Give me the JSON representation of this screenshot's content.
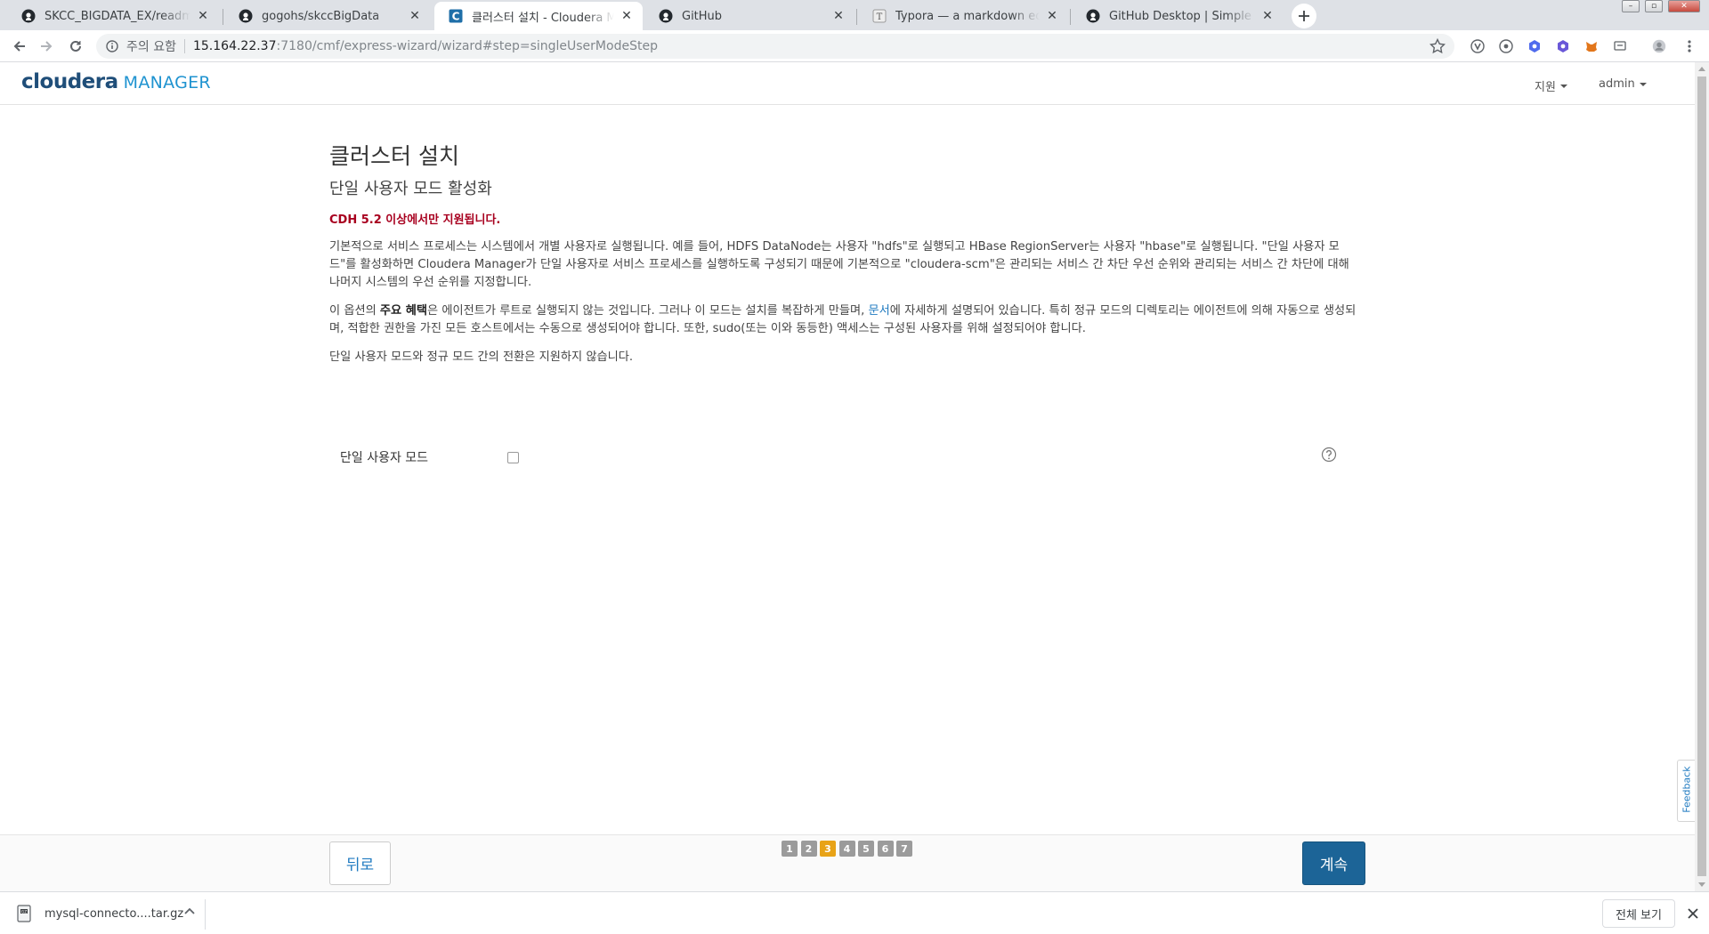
{
  "browser": {
    "tabs": [
      {
        "title": "SKCC_BIGDATA_EX/readme.md at master",
        "icon": "github-icon"
      },
      {
        "title": "gogohs/skccBigData",
        "icon": "github-icon"
      },
      {
        "title": "클러스터 설치 - Cloudera Manager",
        "icon": "cloudera-icon"
      },
      {
        "title": "GitHub",
        "icon": "github-icon"
      },
      {
        "title": "Typora — a markdown editor, markdown reader",
        "icon": "typora-icon"
      },
      {
        "title": "GitHub Desktop | Simple collaboration",
        "icon": "github-icon"
      }
    ],
    "address": {
      "security_text": "주의 요함",
      "host": "15.164.22.37",
      "path": ":7180/cmf/express-wizard/wizard#step=singleUserModeStep"
    }
  },
  "header": {
    "logo_main": "cloudera",
    "logo_sub": "MANAGER",
    "support_label": "지원",
    "user_label": "admin"
  },
  "wizard": {
    "title": "클러스터 설치",
    "subtitle": "단일 사용자 모드 활성화",
    "requirement": "CDH 5.2 이상에서만 지원됩니다.",
    "para1": "기본적으로 서비스 프로세스는 시스템에서 개별 사용자로 실행됩니다. 예를 들어, HDFS DataNode는 사용자 \"hdfs\"로 실행되고 HBase RegionServer는 사용자 \"hbase\"로 실행됩니다. \"단일 사용자 모드\"를 활성화하면 Cloudera Manager가 단일 사용자로 서비스 프로세스를 실행하도록 구성되기 때문에 기본적으로 \"cloudera-scm\"은 관리되는 서비스 간 차단 우선 순위와 관리되는 서비스 간 차단에 대해 나머지 시스템의 우선 순위를 지정합니다.",
    "para2_a": "이 옵션의 ",
    "para2_bold": "주요 혜택",
    "para2_b": "은 에이전트가 루트로 실행되지 않는 것입니다. 그러나 이 모드는 설치를 복잡하게 만들며, ",
    "para2_link": "문서",
    "para2_c": "에 자세하게 설명되어 있습니다. 특히 정규 모드의 디렉토리는 에이전트에 의해 자동으로 생성되며, 적합한 권한을 가진 모든 호스트에서는 수동으로 생성되어야 합니다. 또한, sudo(또는 이와 동등한) 액세스는 구성된 사용자를 위해 설정되어야 합니다.",
    "para3": "단일 사용자 모드와 정규 모드 간의 전환은 지원하지 않습니다.",
    "single_user_label": "단일 사용자 모드",
    "single_user_checked": false
  },
  "footer": {
    "back_label": "뒤로",
    "next_label": "계속",
    "steps": [
      "1",
      "2",
      "3",
      "4",
      "5",
      "6",
      "7"
    ],
    "current_step": 3
  },
  "feedback_label": "Feedback",
  "downloads": {
    "file_name": "mysql-connecto....tar.gz",
    "show_all_label": "전체 보기"
  },
  "colors": {
    "brand_dark": "#1f4e79",
    "brand_light": "#1f93d0",
    "requirement_red": "#a8001f",
    "primary_button": "#1c6497",
    "active_step": "#e8a317"
  }
}
